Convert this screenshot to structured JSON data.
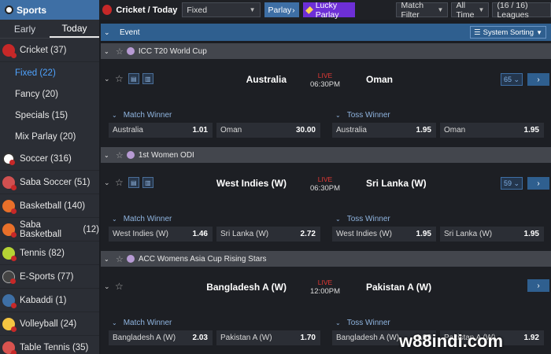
{
  "sidebar": {
    "title": "Sports",
    "tabs": [
      "Early",
      "Today"
    ],
    "items": [
      {
        "label": "Cricket",
        "count": "(37)",
        "color": "#c62828"
      },
      {
        "label": "Soccer",
        "count": "(316)",
        "color": "#ffffff"
      },
      {
        "label": "Saba Soccer",
        "count": "(51)",
        "color": "#d05050"
      },
      {
        "label": "Basketball",
        "count": "(140)",
        "color": "#e8702a"
      },
      {
        "label": "Saba Basketball",
        "count": "(12)",
        "color": "#e8702a"
      },
      {
        "label": "Tennis",
        "count": "(82)",
        "color": "#b5d334"
      },
      {
        "label": "E-Sports",
        "count": "(77)",
        "color": "#444444"
      },
      {
        "label": "Kabaddi",
        "count": "(1)",
        "color": "#3e6fa5"
      },
      {
        "label": "Volleyball",
        "count": "(24)",
        "color": "#f4c542"
      },
      {
        "label": "Table Tennis",
        "count": "(35)",
        "color": "#d9534f"
      }
    ],
    "subitems": [
      {
        "label": "Fixed",
        "count": "(22)"
      },
      {
        "label": "Fancy",
        "count": "(20)"
      },
      {
        "label": "Specials",
        "count": "(15)"
      },
      {
        "label": "Mix Parlay",
        "count": "(20)"
      }
    ]
  },
  "topbar": {
    "title": "Cricket / Today",
    "type_select": "Fixed",
    "parlay": "Parlay",
    "lucky": "Lucky Parlay",
    "match_filter": "Match Filter",
    "all_time": "All Time",
    "leagues": "(16 / 16) Leagues"
  },
  "event_header": {
    "label": "Event",
    "sort": "System Sorting"
  },
  "leagues": [
    {
      "name": "ICC T20 World Cup",
      "match": {
        "home": "Australia",
        "away": "Oman",
        "live": "LIVE",
        "time": "06:30PM",
        "more": "65",
        "markets": [
          {
            "title": "Match Winner",
            "odds": [
              {
                "name": "Australia",
                "price": "1.01"
              },
              {
                "name": "Oman",
                "price": "30.00"
              }
            ]
          },
          {
            "title": "Toss Winner",
            "odds": [
              {
                "name": "Australia",
                "price": "1.95"
              },
              {
                "name": "Oman",
                "price": "1.95"
              }
            ]
          }
        ]
      }
    },
    {
      "name": "1st Women ODI",
      "match": {
        "home": "West Indies (W)",
        "away": "Sri Lanka (W)",
        "live": "LIVE",
        "time": "06:30PM",
        "more": "59",
        "markets": [
          {
            "title": "Match Winner",
            "odds": [
              {
                "name": "West Indies (W)",
                "price": "1.46"
              },
              {
                "name": "Sri Lanka (W)",
                "price": "2.72"
              }
            ]
          },
          {
            "title": "Toss Winner",
            "odds": [
              {
                "name": "West Indies (W)",
                "price": "1.95"
              },
              {
                "name": "Sri Lanka (W)",
                "price": "1.95"
              }
            ]
          }
        ]
      }
    },
    {
      "name": "ACC Womens Asia Cup Rising Stars",
      "match": {
        "home": "Bangladesh A (W)",
        "away": "Pakistan A (W)",
        "live": "LIVE",
        "time": "12:00PM",
        "more": "",
        "markets": [
          {
            "title": "Match Winner",
            "odds": [
              {
                "name": "Bangladesh A (W)",
                "price": "2.03"
              },
              {
                "name": "Pakistan A (W)",
                "price": "1.70"
              }
            ]
          },
          {
            "title": "Toss Winner",
            "odds": [
              {
                "name": "Bangladesh A (W)",
                "price": "1.92"
              },
              {
                "name": "Pakistan A (W)",
                "price": "1.92"
              }
            ]
          }
        ]
      }
    }
  ],
  "watermark": "w88indi.com"
}
